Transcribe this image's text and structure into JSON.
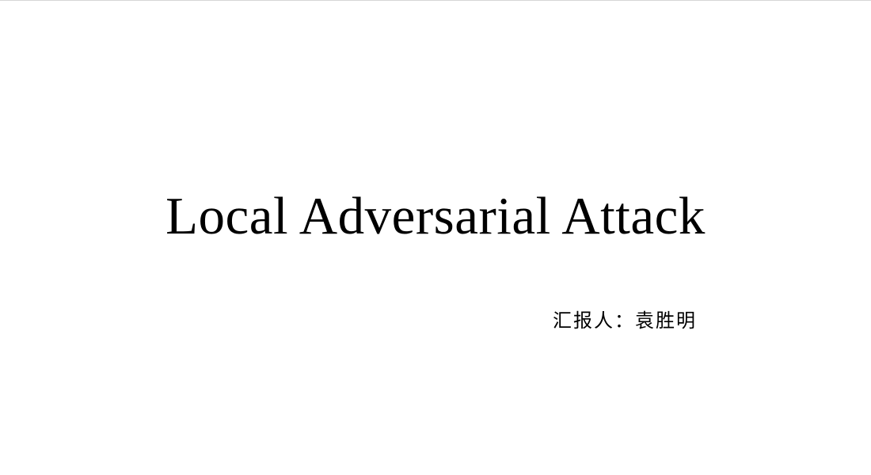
{
  "slide": {
    "title": "Local Adversarial Attack",
    "presenter": "汇报人：袁胜明"
  }
}
